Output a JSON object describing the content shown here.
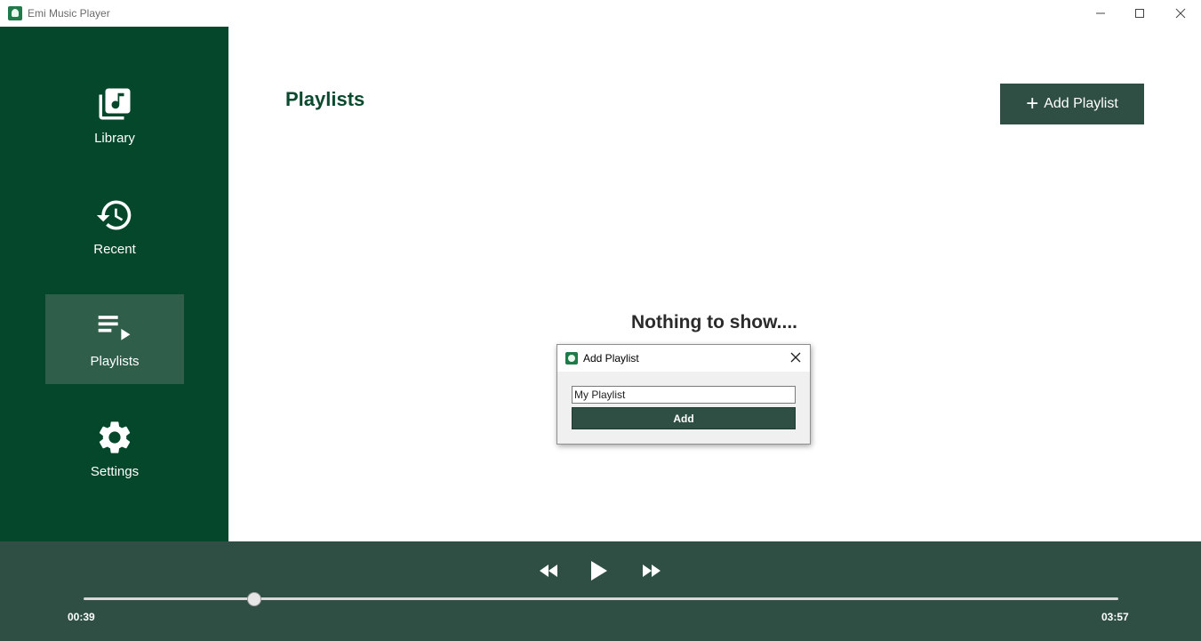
{
  "window": {
    "title": "Emi Music Player"
  },
  "sidebar": {
    "items": [
      {
        "label": "Library",
        "icon": "library-music-icon",
        "active": false
      },
      {
        "label": "Recent",
        "icon": "history-icon",
        "active": false
      },
      {
        "label": "Playlists",
        "icon": "playlist-play-icon",
        "active": true
      },
      {
        "label": "Settings",
        "icon": "gear-icon",
        "active": false
      }
    ]
  },
  "main": {
    "title": "Playlists",
    "add_button_label": "Add Playlist",
    "empty_text": "Nothing to show...."
  },
  "dialog": {
    "title": "Add Playlist",
    "input_value": "My Playlist",
    "add_label": "Add"
  },
  "player": {
    "current_time": "00:39",
    "total_time": "03:57",
    "progress": 0.1649
  },
  "colors": {
    "sidebar_bg": "#04472a",
    "sidebar_active_bg": "#2f5e4a",
    "player_bg": "#304f44",
    "accent_dark": "#304f44",
    "title_green": "#0b4a2e"
  }
}
